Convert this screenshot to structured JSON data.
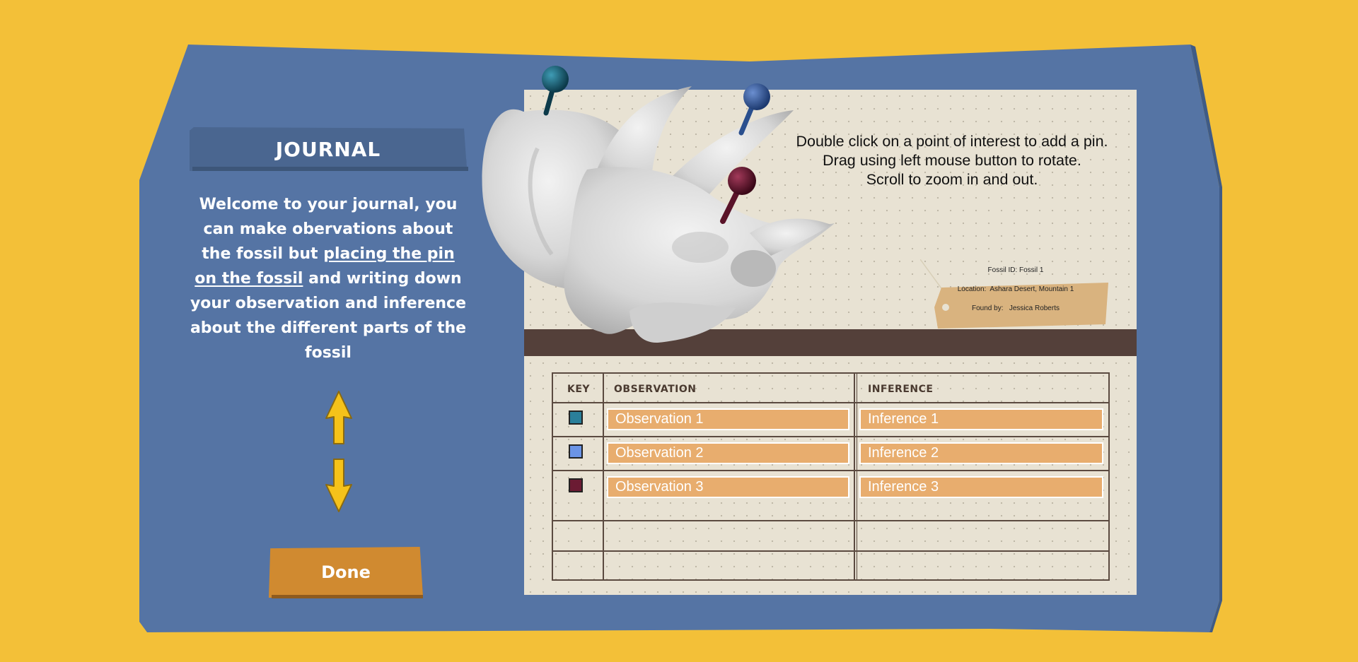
{
  "journal": {
    "title": "JOURNAL",
    "intro_part1": "Welcome to your journal, you can make obervations about the fossil but ",
    "intro_link": "placing the pin on the fossil",
    "intro_part2": " and writing down your observation and inference about the different parts of the fossil",
    "done_label": "Done"
  },
  "viewer": {
    "instructions": [
      "Double click on a point of interest to add a pin.",
      "Drag using left mouse button to rotate.",
      "Scroll to zoom in and out."
    ]
  },
  "tag": {
    "fossil_id_label": "Fossil ID:",
    "fossil_id": "Fossil 1",
    "location_label": "Location:",
    "location": "Ashara Desert, Mountain 1",
    "found_by_label": "Found by:",
    "found_by": "Jessica Roberts"
  },
  "table": {
    "headers": {
      "key": "KEY",
      "observation": "OBSERVATION",
      "inference": "INFERENCE"
    },
    "rows": [
      {
        "key_color": "#2a7f9a",
        "observation": "Observation 1",
        "inference": "Inference 1"
      },
      {
        "key_color": "#6b94e6",
        "observation": "Observation 2",
        "inference": "Inference 2"
      },
      {
        "key_color": "#6b1b33",
        "observation": "Observation 3",
        "inference": "Inference 3"
      }
    ]
  },
  "pins": [
    {
      "color": "#145064"
    },
    {
      "color": "#2a4f8e"
    },
    {
      "color": "#5a1328"
    }
  ],
  "colors": {
    "background": "#f3c038",
    "panel": "#5574a4",
    "header": "#4a6690",
    "done": "#d08a30",
    "arrow": "#f5c21a",
    "input": "#e8ad6e"
  }
}
